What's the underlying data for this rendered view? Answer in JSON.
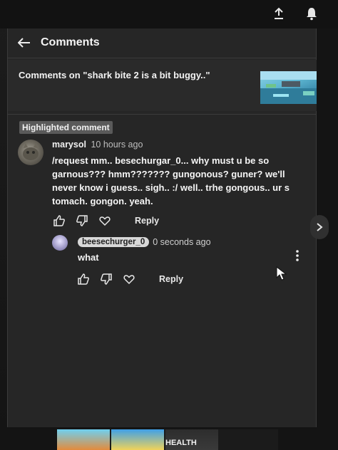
{
  "header": {
    "title": "Comments"
  },
  "context": {
    "text": "Comments on \"shark bite 2 is a bit buggy..\""
  },
  "highlighted_badge": "Highlighted comment",
  "comment": {
    "author": "marysol",
    "time": "10 hours ago",
    "text": "/request mm.. besechurgar_0... why must u be so garnous??? hmm??????? gungonous? guner? we'll never know i guess.. sigh.. :/ well.. trhe gongous.. ur s tomach. gongon. yeah.",
    "reply_label": "Reply"
  },
  "reply": {
    "author": "beesechurger_0",
    "time": "0 seconds ago",
    "text": "what",
    "reply_label": "Reply"
  },
  "bottom": {
    "label": "HEALTH"
  },
  "icons": {
    "upload": "upload-icon",
    "notifications": "bell-icon",
    "back": "arrow-left-icon",
    "like": "thumbs-up-icon",
    "dislike": "thumbs-down-icon",
    "heart": "heart-icon",
    "more": "more-vertical-icon",
    "next": "chevron-right-icon"
  },
  "colors": {
    "panel": "#262626",
    "background": "#151515",
    "chip": "#d8d8d8"
  }
}
